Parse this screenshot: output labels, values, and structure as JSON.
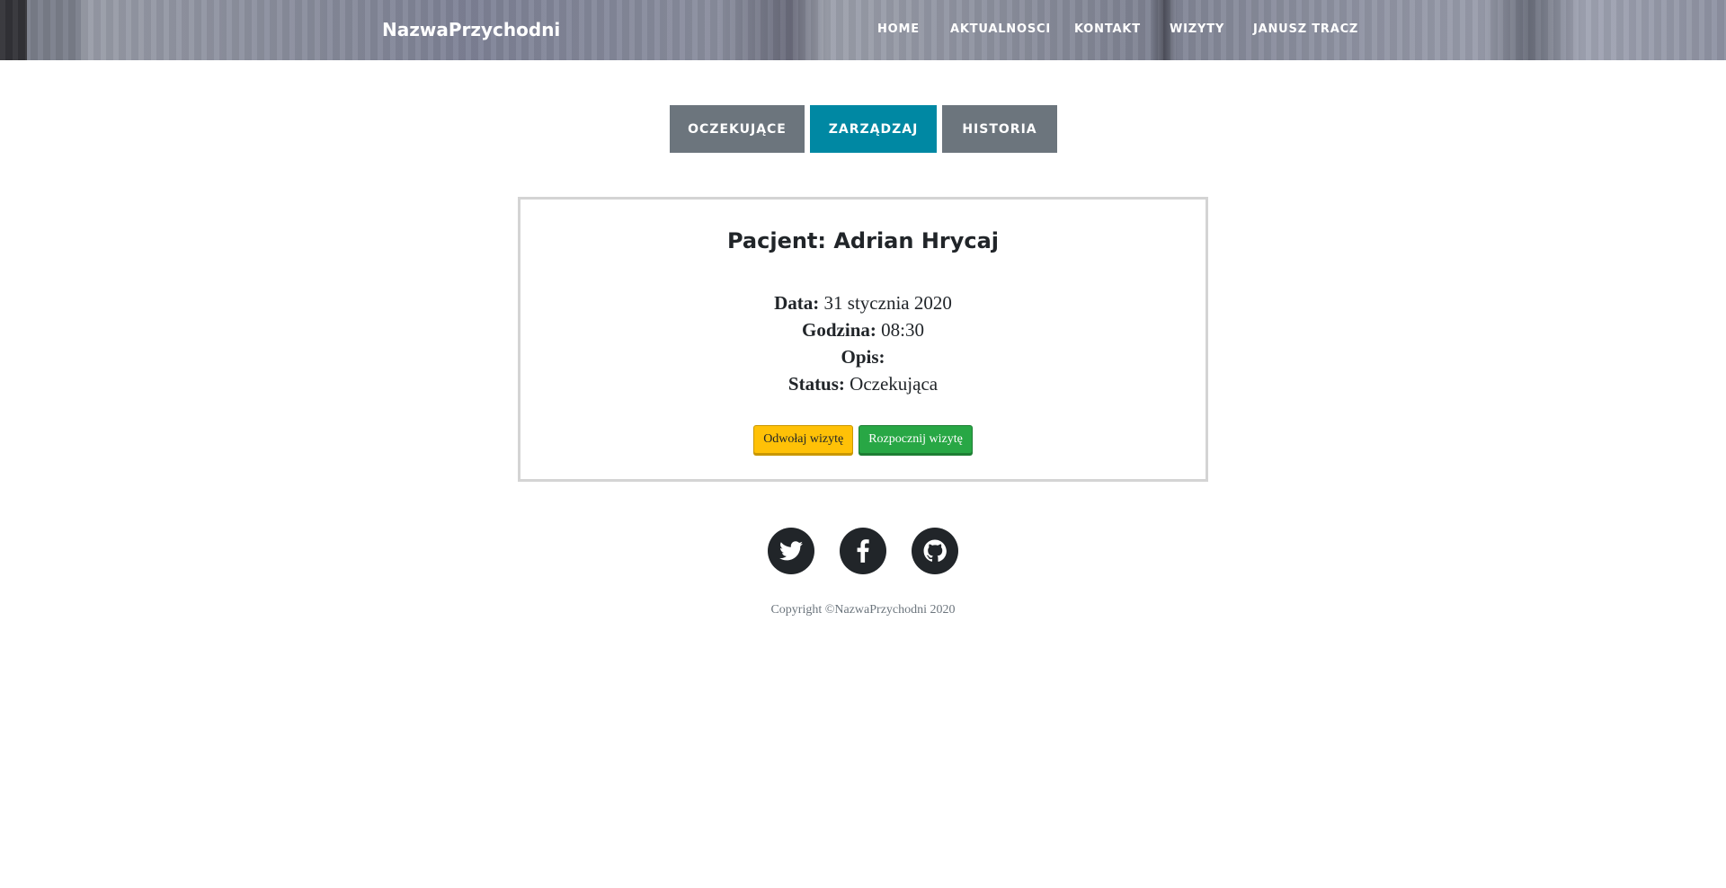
{
  "navbar": {
    "brand": "NazwaPrzychodni",
    "links": [
      "HOME",
      "AKTUALNOSCI",
      "KONTAKT",
      "WIZYTY",
      "JANUSZ TRACZ"
    ]
  },
  "tabs": {
    "pending": "OCZEKUJĄCE",
    "manage": "ZARZĄDZAJ",
    "history": "HISTORIA",
    "active": "ZARZĄDZAJ"
  },
  "visit": {
    "patient_label": "Pacjent:",
    "patient_name": "Adrian Hrycaj",
    "date_label": "Data:",
    "date_value": "31 stycznia 2020",
    "time_label": "Godzina:",
    "time_value": "08:30",
    "description_label": "Opis:",
    "description_value": "",
    "status_label": "Status:",
    "status_value": "Oczekująca"
  },
  "actions": {
    "cancel": "Odwołaj wizytę",
    "start": "Rozpocznij wizytę"
  },
  "footer": {
    "social": [
      "twitter-icon",
      "facebook-icon",
      "github-icon"
    ],
    "copyright": "Copyright ©NazwaPrzychodni 2020"
  },
  "colors": {
    "tab_active": "#0088a3",
    "tab_inactive": "#6c757d",
    "cancel_button": "#ffc107",
    "start_button": "#28a745",
    "social_bg": "#212529"
  }
}
